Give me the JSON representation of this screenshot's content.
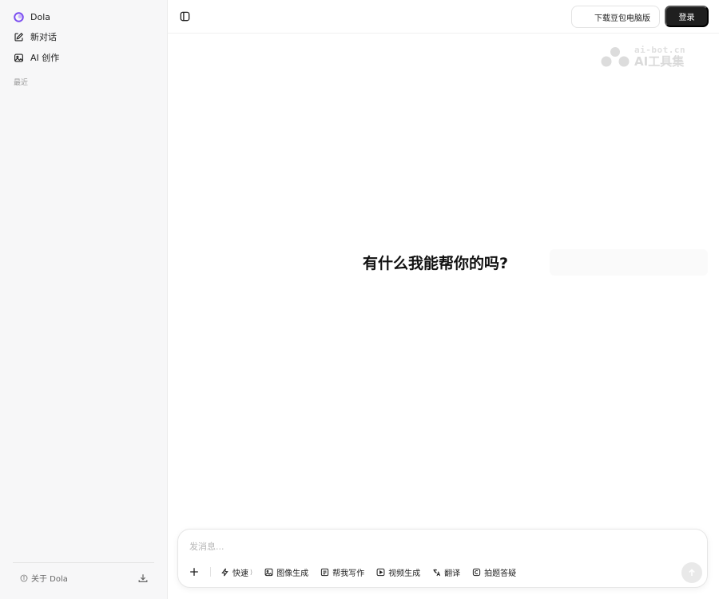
{
  "sidebar": {
    "app_name": "Dola",
    "items": [
      {
        "label": "新对话",
        "icon": "edit-icon"
      },
      {
        "label": "AI 创作",
        "icon": "image-icon"
      }
    ],
    "recent_label": "最近",
    "about_label": "关于 Dola",
    "download_icon": "download-icon"
  },
  "header": {
    "download_button_label": "下载豆包电脑版",
    "login_button_label": "登录"
  },
  "watermark": {
    "url": "ai-bot.cn",
    "name": "AI工具集"
  },
  "main": {
    "title": "有什么我能帮你的吗?"
  },
  "composer": {
    "placeholder": "发消息...",
    "tools": [
      {
        "label": "快速",
        "icon": "bolt-icon",
        "has_chevron": true
      },
      {
        "label": "图像生成",
        "icon": "image-icon"
      },
      {
        "label": "帮我写作",
        "icon": "document-icon"
      },
      {
        "label": "视频生成",
        "icon": "video-icon"
      },
      {
        "label": "翻译",
        "icon": "translate-icon"
      },
      {
        "label": "拍题答疑",
        "icon": "camera-icon"
      }
    ],
    "tool_chevron": "⟩"
  },
  "colors": {
    "accent_dark": "#1f1f1f",
    "logo_purple": "#7a4cf0"
  }
}
